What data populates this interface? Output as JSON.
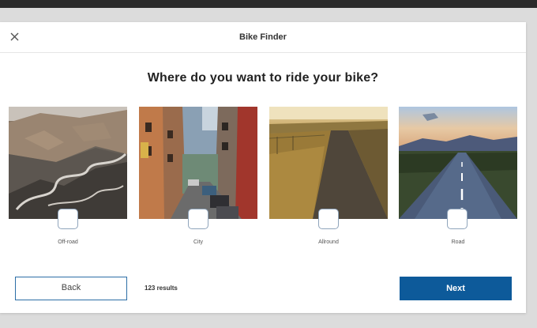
{
  "header": {
    "title": "Bike Finder",
    "close_icon": "close-icon"
  },
  "question": "Where do you want to ride your bike?",
  "options": [
    {
      "label": "Off-road",
      "checked": false
    },
    {
      "label": "City",
      "checked": false
    },
    {
      "label": "Allround",
      "checked": false
    },
    {
      "label": "Road",
      "checked": false
    }
  ],
  "footer": {
    "back_label": "Back",
    "results_text": "123 results",
    "next_label": "Next"
  },
  "colors": {
    "accent": "#0d5a9a",
    "back_border": "#2c6ea6",
    "checkbox_border": "#8fa4bb"
  }
}
